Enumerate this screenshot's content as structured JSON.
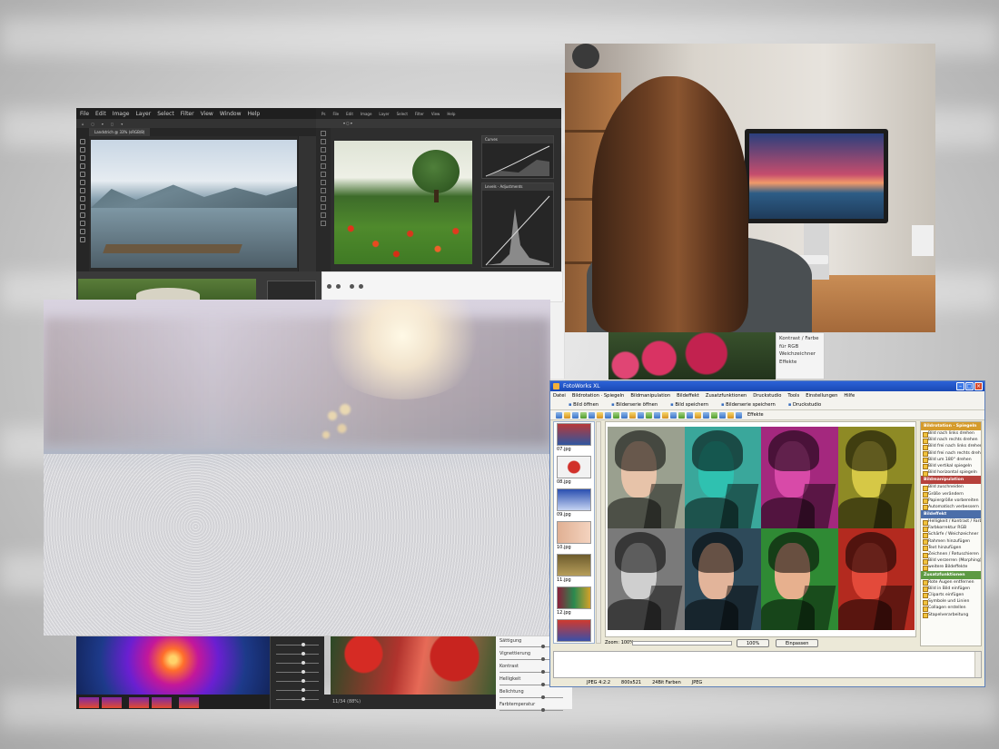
{
  "colors": {
    "fw_title": "#1a49b4",
    "panel_yellow": "#d59b2b",
    "panel_red": "#b6413c",
    "panel_blue": "#4b6ea9",
    "panel_green": "#5d9a43"
  },
  "ps": {
    "menu": [
      "File",
      "Edit",
      "Image",
      "Layer",
      "Select",
      "Filter",
      "View",
      "Window",
      "Help"
    ],
    "doc_tab": "Landstrich @ 33% (sRGB/8)"
  },
  "ps2": {
    "menu": [
      "Ps",
      "File",
      "Edit",
      "Image",
      "Layer",
      "Select",
      "Filter",
      "View",
      "Help"
    ],
    "panel1": "Curves",
    "panel2": "Levels · Adjustments"
  },
  "menu_snip": [
    "Kontrast / Farbe",
    "für RGB",
    "Weichzeichner",
    "Effekte"
  ],
  "path_bar": "11/34 (88%)",
  "sliders2": [
    "Sättigung",
    "Vignettierung",
    "Kontrast",
    "Helligkeit",
    "Belichtung",
    "Farbtemperatur"
  ],
  "fotoworks": {
    "title": "FotoWorks XL",
    "menu": [
      "Datei",
      "Bildrotation · Spiegeln",
      "Bildmanipulation",
      "Bildeffekt",
      "Zusatzfunktionen",
      "Druckstudio",
      "Tools",
      "Einstellungen",
      "Hilfe"
    ],
    "actions": [
      "Bild öffnen",
      "Bilderserie öffnen",
      "Bild speichern",
      "Bilderserie speichern",
      "Druckstudio"
    ],
    "effects_label": "Effekte",
    "thumbs": [
      "07.jpg",
      "08.jpg",
      "09.jpg",
      "10.jpg",
      "11.jpg",
      "12.jpg",
      "13.jpg"
    ],
    "zoom_label": "Zoom: 100%",
    "zoom_button": "100%",
    "fit_button": "Einpassen",
    "panel": {
      "sec1": "Bildrotation · Spiegeln",
      "sec1_items": [
        "Bild nach links drehen",
        "Bild nach rechts drehen",
        "Bild frei nach links drehen",
        "Bild frei nach rechts drehen",
        "Bild um 180° drehen",
        "Bild vertikal spiegeln",
        "Bild horizontal spiegeln"
      ],
      "sec2": "Bildmanipulation",
      "sec2_items": [
        "Bild zuschneiden",
        "Größe verändern",
        "Papiergröße vorbereiten",
        "Automatisch verbessern"
      ],
      "sec3": "Bildeffekt",
      "sec3_items": [
        "Helligkeit / Kontrast / Farbe",
        "Farbkorrektur RGB",
        "Schärfe / Weichzeichner",
        "Rahmen hinzufügen",
        "Text hinzufügen",
        "Zeichnen / Retuschieren",
        "Bild verzerren (Morphing)",
        "weitere Bildeffekte"
      ],
      "sec4": "Zusatzfunktionen",
      "sec4_items": [
        "Rote Augen entfernen",
        "Bild in Bild einfügen",
        "Cliparts einfügen",
        "Symbole und Linien",
        "Collagen erstellen",
        "Stapelverarbeitung"
      ]
    },
    "status": [
      "JPEG 4:2:2",
      "800x521",
      "24Bit Farben",
      "JPEG"
    ]
  }
}
